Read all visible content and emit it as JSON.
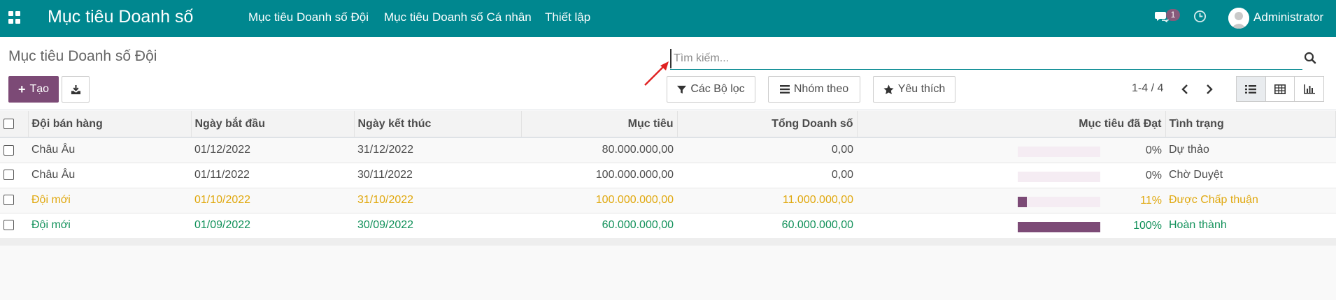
{
  "navbar": {
    "brand": "Mục tiêu Doanh số",
    "menu": [
      "Mục tiêu Doanh số Đội",
      "Mục tiêu Doanh số Cá nhân",
      "Thiết lập"
    ],
    "chat_count": "1",
    "user": "Administrator",
    "bg_color": "#00878f"
  },
  "control": {
    "breadcrumb": "Mục tiêu Doanh số Đội",
    "search_placeholder": "Tìm kiếm...",
    "create_label": "Tạo",
    "filters_label": "Các Bộ lọc",
    "groupby_label": "Nhóm theo",
    "favorites_label": "Yêu thích",
    "pager": "1-4 / 4",
    "accent": "#7c4a76"
  },
  "table": {
    "columns": [
      "Đội bán hàng",
      "Ngày bắt đầu",
      "Ngày kết thúc",
      "Mục tiêu",
      "Tổng Doanh số",
      "Mục tiêu đã Đạt",
      "Tình trạng"
    ],
    "rows": [
      {
        "team": "Châu Âu",
        "start": "01/12/2022",
        "end": "31/12/2022",
        "target": "80.000.000,00",
        "total": "0,00",
        "achieved_pct": 0,
        "achieved": "0%",
        "status": "Dự thảo"
      },
      {
        "team": "Châu Âu",
        "start": "01/11/2022",
        "end": "30/11/2022",
        "target": "100.000.000,00",
        "total": "0,00",
        "achieved_pct": 0,
        "achieved": "0%",
        "status": "Chờ Duyệt"
      },
      {
        "team": "Đội mới",
        "start": "01/10/2022",
        "end": "31/10/2022",
        "target": "100.000.000,00",
        "total": "11.000.000,00",
        "achieved_pct": 11,
        "achieved": "11%",
        "status": "Được Chấp thuận"
      },
      {
        "team": "Đội mới",
        "start": "01/09/2022",
        "end": "30/09/2022",
        "target": "60.000.000,00",
        "total": "60.000.000,00",
        "achieved_pct": 100,
        "achieved": "100%",
        "status": "Hoàn thành"
      }
    ]
  }
}
